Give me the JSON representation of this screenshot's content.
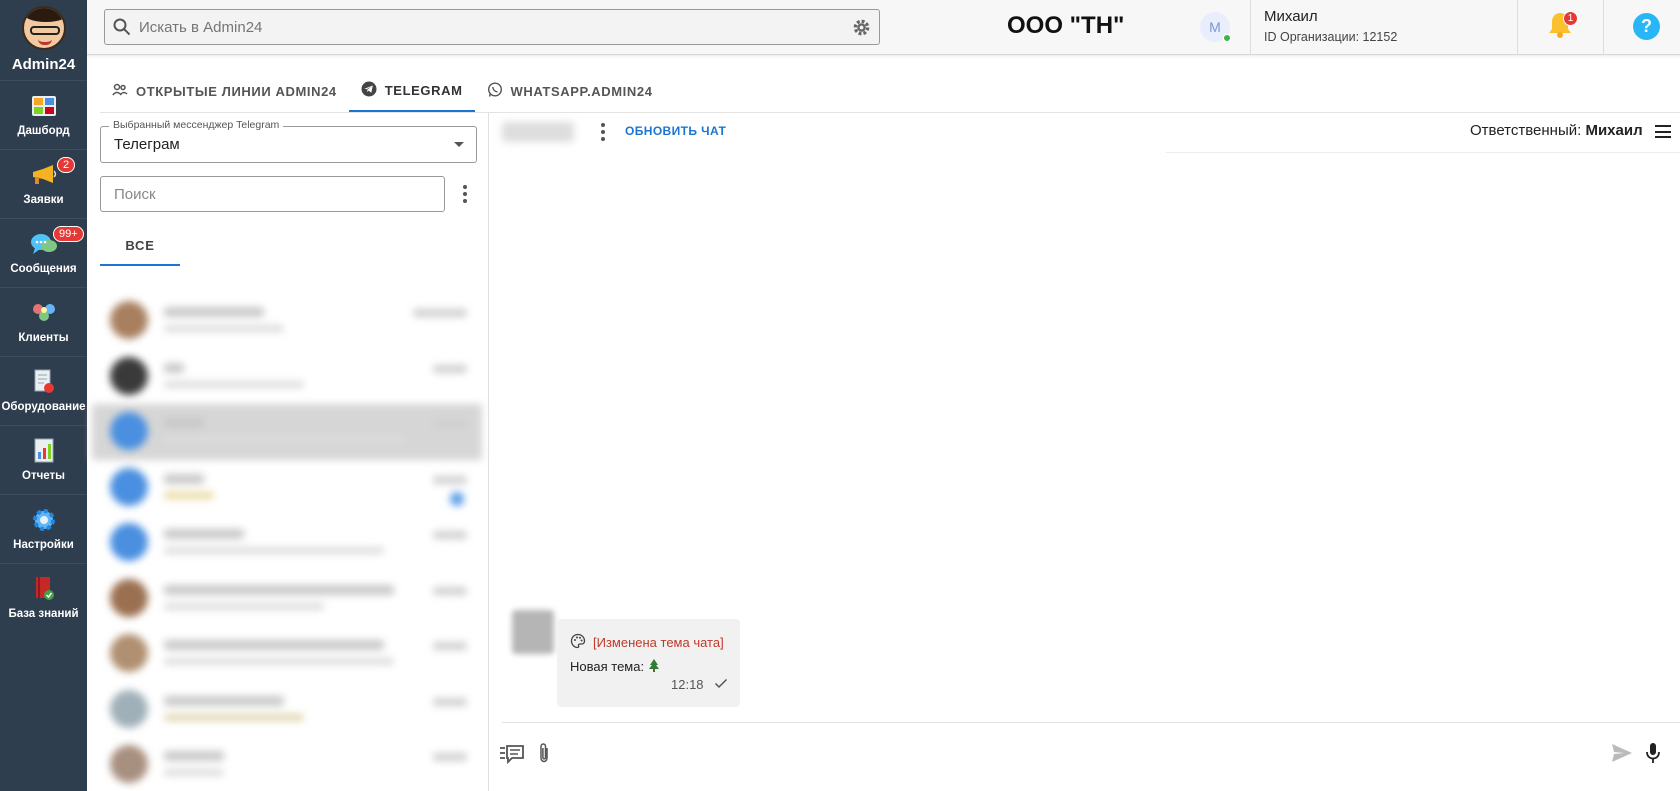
{
  "brand": {
    "name": "Admin24"
  },
  "sidebar": {
    "items": [
      {
        "label": "Дашборд",
        "icon": "dashboard-icon",
        "badge": ""
      },
      {
        "label": "Заявки",
        "icon": "megaphone-icon",
        "badge": "2"
      },
      {
        "label": "Сообщения",
        "icon": "messages-icon",
        "badge": "99+"
      },
      {
        "label": "Клиенты",
        "icon": "clients-icon",
        "badge": ""
      },
      {
        "label": "Оборудование",
        "icon": "equipment-icon",
        "badge": ""
      },
      {
        "label": "Отчеты",
        "icon": "reports-icon",
        "badge": ""
      },
      {
        "label": "Настройки",
        "icon": "settings-icon",
        "badge": ""
      },
      {
        "label": "База знаний",
        "icon": "knowledge-base-icon",
        "badge": ""
      }
    ]
  },
  "header": {
    "search_placeholder": "Искать в Admin24",
    "org_title": "ООО \"ТН\"",
    "user_initial": "M",
    "user_name": "Михаил",
    "org_id": "ID Организации: 12152",
    "notifications_count": "1",
    "help_symbol": "?"
  },
  "tabs": [
    {
      "label": "ОТКРЫТЫЕ ЛИНИИ ADMIN24",
      "icon": "people-icon",
      "active": false
    },
    {
      "label": "TELEGRAM",
      "icon": "telegram-icon",
      "active": true
    },
    {
      "label": "WHATSAPP.ADMIN24",
      "icon": "whatsapp-icon",
      "active": false
    }
  ],
  "left_panel": {
    "messenger_select_label": "Выбранный мессенджер Telegram",
    "messenger_select_value": "Телеграм",
    "search_placeholder": "Поиск",
    "filter_tab": "ВСЕ"
  },
  "chat": {
    "refresh_label": "ОБНОВИТЬ ЧАТ",
    "responsible_label": "Ответственный:",
    "responsible_name": "Михаил",
    "message": {
      "event": "[Изменена тема чата]",
      "text": "Новая тема:",
      "time": "12:18"
    }
  },
  "colors": {
    "sidebar_bg": "#2f3e4e",
    "accent": "#1976d2",
    "badge": "#e53935",
    "event_text": "#c0392b"
  }
}
